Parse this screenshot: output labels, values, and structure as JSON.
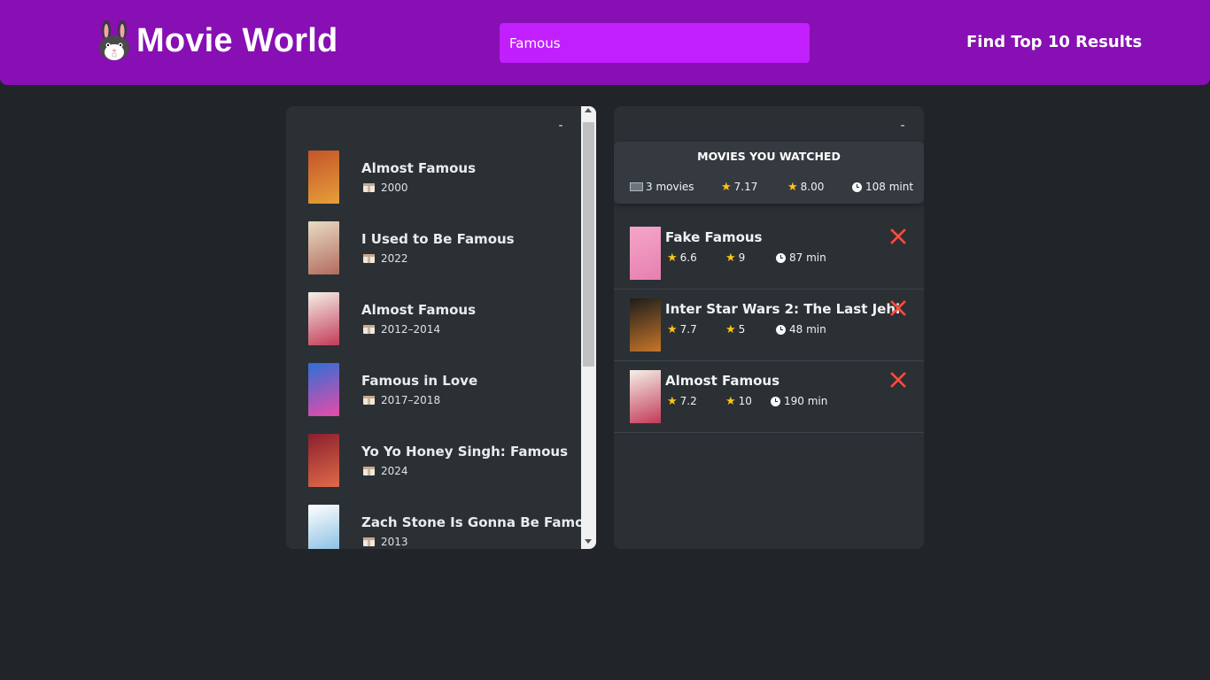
{
  "header": {
    "logo_text": "Movie World",
    "logo_icon": "rabbit-icon",
    "search_value": "Famous",
    "results_text": "Find Top 10 Results"
  },
  "search_panel": {
    "toggle_label": "-",
    "movies": [
      {
        "title": "Almost Famous",
        "year": "2000",
        "poster_colors": [
          "#c4542a",
          "#e6a03a"
        ]
      },
      {
        "title": "I Used to Be Famous",
        "year": "2022",
        "poster_colors": [
          "#e8dcc6",
          "#b36b5c"
        ]
      },
      {
        "title": "Almost Famous",
        "year": "2012–2014",
        "poster_colors": [
          "#f5f0e8",
          "#c23b57"
        ]
      },
      {
        "title": "Famous in Love",
        "year": "2017–2018",
        "poster_colors": [
          "#2f6fd6",
          "#e94ba8"
        ]
      },
      {
        "title": "Yo Yo Honey Singh: Famous",
        "year": "2024",
        "poster_colors": [
          "#8a1f2d",
          "#e06a4a"
        ]
      },
      {
        "title": "Zach Stone Is Gonna Be Famous",
        "year": "2013",
        "poster_colors": [
          "#ffffff",
          "#7bb7e0"
        ]
      }
    ]
  },
  "watched_panel": {
    "toggle_label": "-",
    "summary": {
      "title": "MOVIES YOU WATCHED",
      "count": "3 movies",
      "avg_imdb": "7.17",
      "avg_user": "8.00",
      "avg_runtime": "108 mint"
    },
    "movies": [
      {
        "title": "Fake Famous",
        "imdb": "6.6",
        "user": "9",
        "runtime": "87 min",
        "poster_colors": [
          "#f4a6c9",
          "#e77fb0"
        ]
      },
      {
        "title": "Inter Star Wars 2: The Last Jehi",
        "imdb": "7.7",
        "user": "5",
        "runtime": "48 min",
        "poster_colors": [
          "#1d1d1b",
          "#c7762a"
        ]
      },
      {
        "title": "Almost Famous",
        "imdb": "7.2",
        "user": "10",
        "runtime": "190 min",
        "poster_colors": [
          "#f5f0e8",
          "#c23b57"
        ]
      }
    ]
  },
  "colors": {
    "navbar": "#870fb3",
    "search_bg": "#c21fff",
    "page_bg": "#212529",
    "panel_bg": "#2b3035",
    "summary_bg": "#343a40",
    "star": "#fcc419",
    "delete": "#e03131"
  }
}
